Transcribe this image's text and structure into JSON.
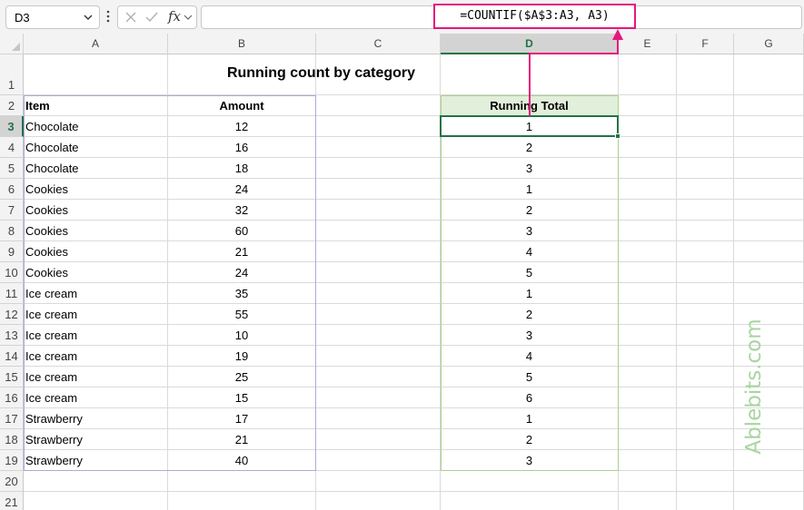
{
  "formula_bar": {
    "name_box": "D3",
    "fx_label": "fx",
    "formula": "=COUNTIF($A$3:A3, A3)",
    "icons": [
      "chevron-down-icon",
      "more-options-icon",
      "cancel-icon",
      "enter-icon",
      "function-icon"
    ]
  },
  "sheet": {
    "columns": [
      "A",
      "B",
      "C",
      "D",
      "E",
      "F",
      "G"
    ],
    "selected_column": "D",
    "selected_row": "3",
    "rows": [
      "1",
      "2",
      "3",
      "4",
      "5",
      "6",
      "7",
      "8",
      "9",
      "10",
      "11",
      "12",
      "13",
      "14",
      "15",
      "16",
      "17",
      "18",
      "19",
      "20",
      "21"
    ],
    "title": "Running count by category",
    "headers": {
      "item": "Item",
      "amount": "Amount",
      "running_total": "Running Total"
    },
    "data": [
      {
        "item": "Chocolate",
        "amount": "12",
        "running": "1"
      },
      {
        "item": "Chocolate",
        "amount": "16",
        "running": "2"
      },
      {
        "item": "Chocolate",
        "amount": "18",
        "running": "3"
      },
      {
        "item": "Cookies",
        "amount": "24",
        "running": "1"
      },
      {
        "item": "Cookies",
        "amount": "32",
        "running": "2"
      },
      {
        "item": "Cookies",
        "amount": "60",
        "running": "3"
      },
      {
        "item": "Cookies",
        "amount": "21",
        "running": "4"
      },
      {
        "item": "Cookies",
        "amount": "24",
        "running": "5"
      },
      {
        "item": "Ice cream",
        "amount": "35",
        "running": "1"
      },
      {
        "item": "Ice cream",
        "amount": "55",
        "running": "2"
      },
      {
        "item": "Ice cream",
        "amount": "10",
        "running": "3"
      },
      {
        "item": "Ice cream",
        "amount": "19",
        "running": "4"
      },
      {
        "item": "Ice cream",
        "amount": "25",
        "running": "5"
      },
      {
        "item": "Ice cream",
        "amount": "15",
        "running": "6"
      },
      {
        "item": "Strawberry",
        "amount": "17",
        "running": "1"
      },
      {
        "item": "Strawberry",
        "amount": "21",
        "running": "2"
      },
      {
        "item": "Strawberry",
        "amount": "40",
        "running": "3"
      }
    ]
  },
  "colors": {
    "accent_pink": "#e5177c",
    "excel_green": "#217346",
    "header_fill": "#e2efda",
    "watermark": "#a8d5a0"
  },
  "watermark": "Ablebits.com"
}
